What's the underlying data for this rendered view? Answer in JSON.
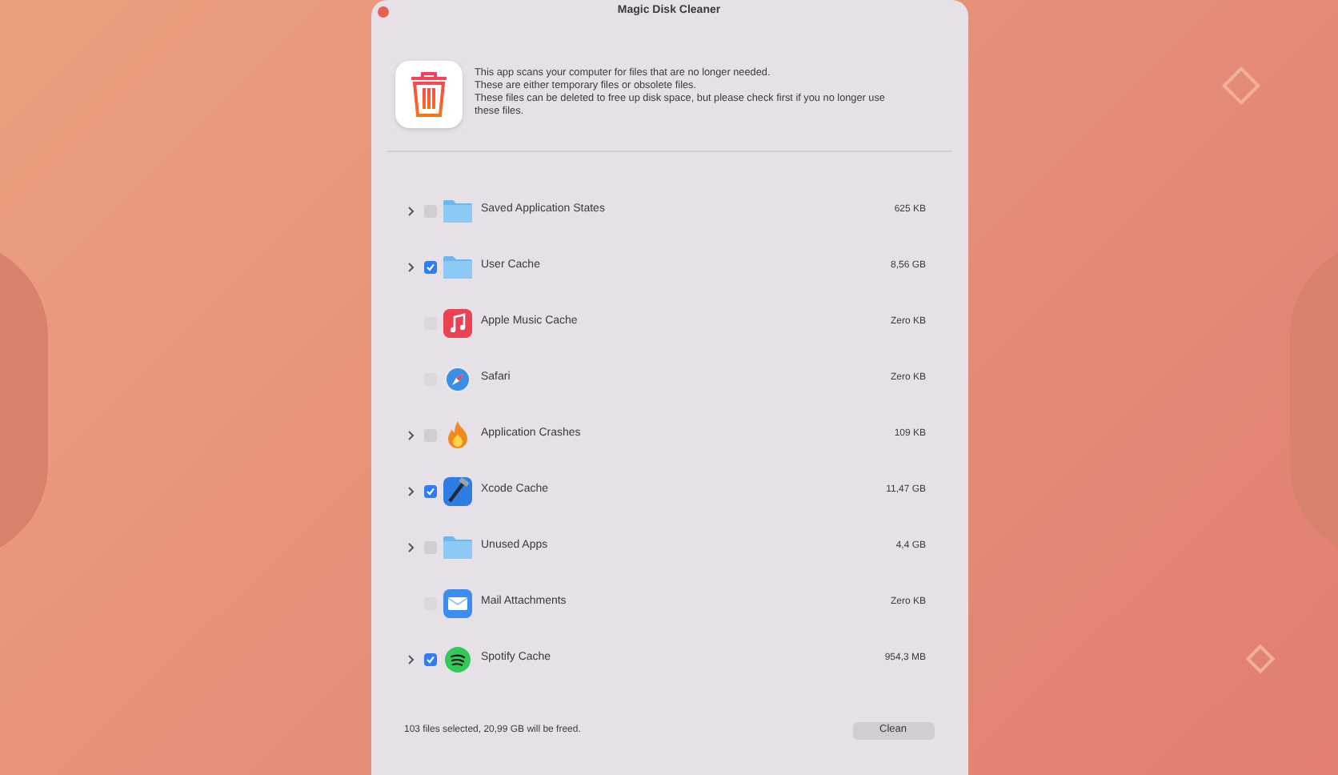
{
  "window": {
    "title": "Magic Disk Cleaner"
  },
  "intro": [
    "This app scans your computer for files that are no longer needed.",
    "These are either temporary files or obsolete files.",
    "These files can be deleted to free up disk space, but please check first if you no longer use these files."
  ],
  "items": [
    {
      "name": "Saved Application States",
      "size": "625 KB",
      "kind": "folder",
      "expandable": true,
      "checked": false
    },
    {
      "name": "User Cache",
      "size": "8,56 GB",
      "kind": "folder",
      "expandable": true,
      "checked": true
    },
    {
      "name": "Apple Music Cache",
      "size": "Zero KB",
      "kind": "music",
      "expandable": false,
      "checked": false
    },
    {
      "name": "Safari",
      "size": "Zero KB",
      "kind": "compass",
      "expandable": false,
      "checked": false
    },
    {
      "name": "Application Crashes",
      "size": "109 KB",
      "kind": "fire",
      "expandable": true,
      "checked": false
    },
    {
      "name": "Xcode Cache",
      "size": "11,47 GB",
      "kind": "hammer",
      "expandable": true,
      "checked": true
    },
    {
      "name": "Unused Apps",
      "size": "4,4 GB",
      "kind": "folder",
      "expandable": true,
      "checked": false
    },
    {
      "name": "Mail Attachments",
      "size": "Zero KB",
      "kind": "mail",
      "expandable": false,
      "checked": false
    },
    {
      "name": "Spotify Cache",
      "size": "954,3 MB",
      "kind": "spotify",
      "expandable": true,
      "checked": true
    }
  ],
  "status": "103 files selected, 20,99 GB will be freed.",
  "buttons": [
    "Clean"
  ]
}
